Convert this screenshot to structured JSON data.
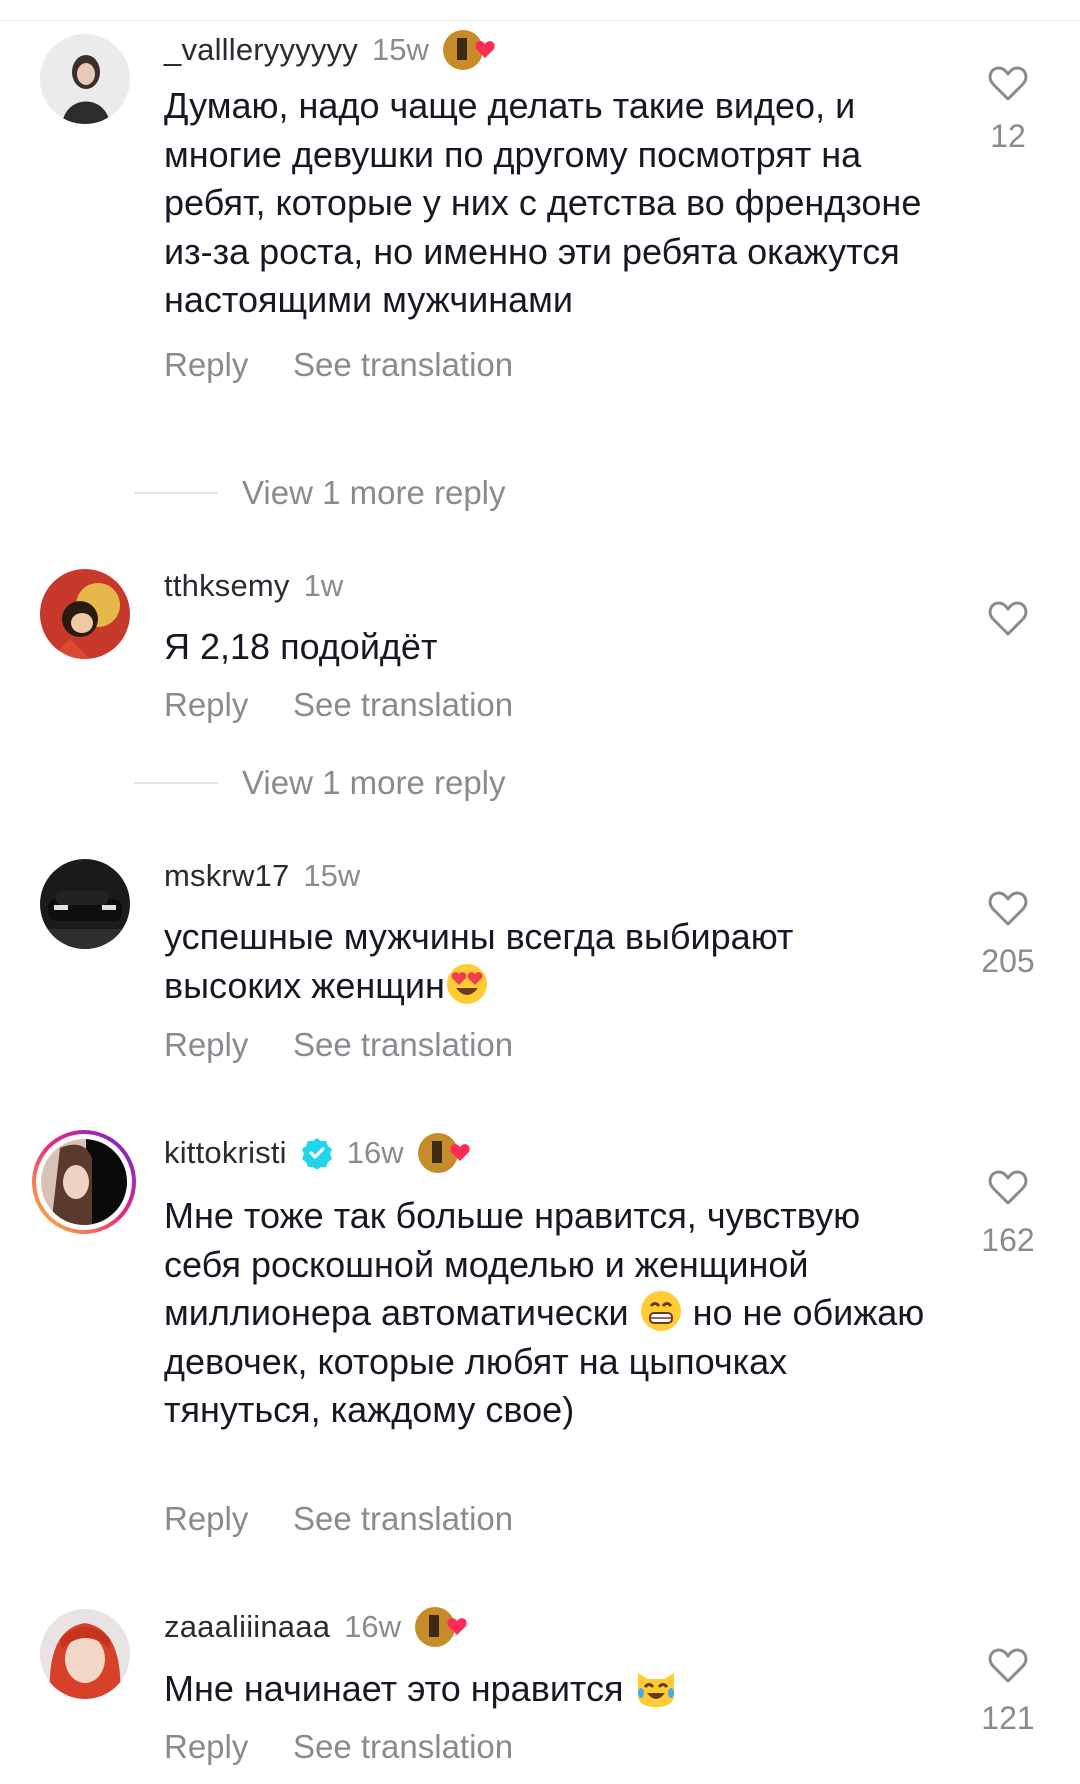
{
  "comments": [
    {
      "username": "_vallleryyyyyy",
      "time": "15w",
      "creator_liked": true,
      "verified": false,
      "text": "Думаю, надо чаще делать такие видео, и многие девушки по другому посмотрят на ребят, которые у них с детства во френдзоне из-за роста, но именно эти ребята окажутся настоящими мужчинами",
      "reply": "Reply",
      "translate": "See translation",
      "likes": "12",
      "more_replies": "View 1 more reply"
    },
    {
      "username": "tthksemy",
      "time": "1w",
      "creator_liked": false,
      "verified": false,
      "text": "Я 2,18 подойдёт",
      "reply": "Reply",
      "translate": "See translation",
      "likes": "",
      "more_replies": "View 1 more reply"
    },
    {
      "username": "mskrw17",
      "time": "15w",
      "creator_liked": false,
      "verified": false,
      "text": "успешные мужчины всегда выбирают высоких женщин",
      "emoji_end": "heart-eyes",
      "reply": "Reply",
      "translate": "See translation",
      "likes": "205"
    },
    {
      "username": "kittokristi",
      "time": "16w",
      "creator_liked": true,
      "verified": true,
      "text_a": "Мне тоже так больше нравится, чувствую себя роскошной моделью и женщиной миллионера автоматически",
      "text_b": " но не обижаю девочек, которые любят на цыпочках тянуться, каждому свое)",
      "emoji_mid": "grin",
      "reply": "Reply",
      "translate": "See translation",
      "likes": "162"
    },
    {
      "username": "zaaaliiinaaa",
      "time": "16w",
      "creator_liked": true,
      "verified": false,
      "text": "Мне начинает это нравится ",
      "emoji_end": "cat-tears-of-joy",
      "reply": "Reply",
      "translate": "See translation",
      "likes": "121"
    }
  ],
  "colors": {
    "heart": "#fe2c55",
    "verified": "#20d5ec",
    "muted": "#8a8b91"
  }
}
